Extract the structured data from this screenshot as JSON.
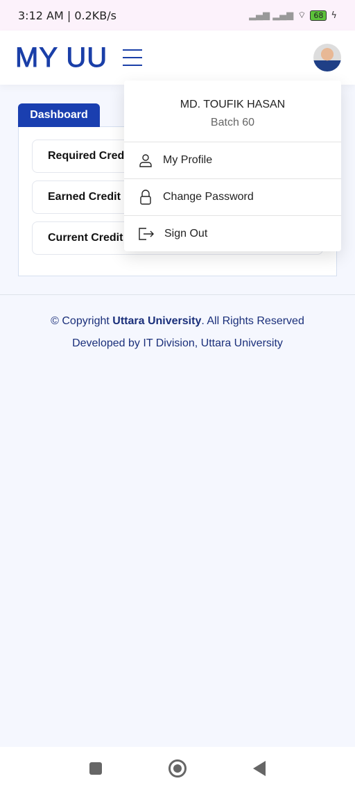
{
  "status_bar": {
    "time": "3:12 AM | 0.2KB/s",
    "battery": "68"
  },
  "header": {
    "logo": "MY UU"
  },
  "dashboard": {
    "tab": "Dashboard",
    "cards": [
      "Required Credit",
      "Earned Credit",
      "Current Credit"
    ]
  },
  "user_menu": {
    "name": "MD. TOUFIK HASAN",
    "batch": "Batch 60",
    "items": [
      {
        "label": "My Profile",
        "icon": "user-icon"
      },
      {
        "label": "Change Password",
        "icon": "lock-icon"
      },
      {
        "label": "Sign Out",
        "icon": "sign-out-icon"
      }
    ]
  },
  "footer": {
    "copyright_prefix": "© Copyright ",
    "university": "Uttara University",
    "copyright_suffix": ". All Rights Reserved",
    "developed": "Developed by IT Division, Uttara University"
  },
  "colors": {
    "brand": "#1a3fb0"
  }
}
